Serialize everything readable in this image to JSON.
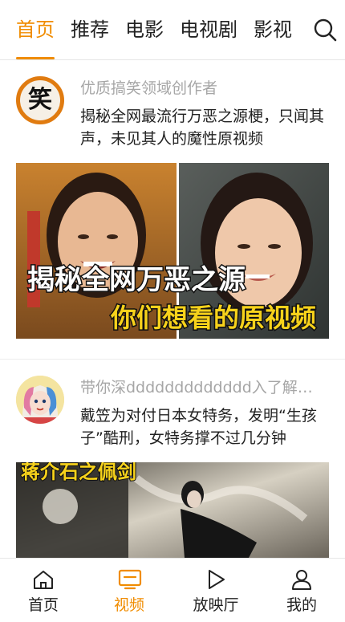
{
  "colors": {
    "accent": "#f08c00",
    "text": "#222222",
    "muted": "#a6a6a6"
  },
  "tabs": [
    {
      "label": "首页",
      "active": true
    },
    {
      "label": "推荐",
      "active": false
    },
    {
      "label": "电影",
      "active": false
    },
    {
      "label": "电视剧",
      "active": false
    },
    {
      "label": "影视",
      "active": false
    }
  ],
  "search": {
    "icon": "search-icon"
  },
  "feed": [
    {
      "avatar_char": "笑",
      "author": "优质搞笑领域创作者",
      "title": "揭秘全网最流行万恶之源梗，只闻其声，未见其人的魔性原视频",
      "thumb_caption_1": "揭秘全网万恶之源",
      "thumb_caption_2": "你们想看的原视频"
    },
    {
      "avatar_icon": "cartoon-avatar-icon",
      "author": "带你深ddddddddddddd入了解每...",
      "title": "戴笠为对付日本女特务，发明“生孩子”酷刑，女特务撑不过几分钟",
      "thumb_caption_1": "蒋介石之佩剑"
    }
  ],
  "bottom_nav": [
    {
      "label": "首页",
      "icon": "home-icon",
      "active": false
    },
    {
      "label": "视频",
      "icon": "tv-icon",
      "active": true
    },
    {
      "label": "放映厅",
      "icon": "play-icon",
      "active": false
    },
    {
      "label": "我的",
      "icon": "user-icon",
      "active": false
    }
  ]
}
